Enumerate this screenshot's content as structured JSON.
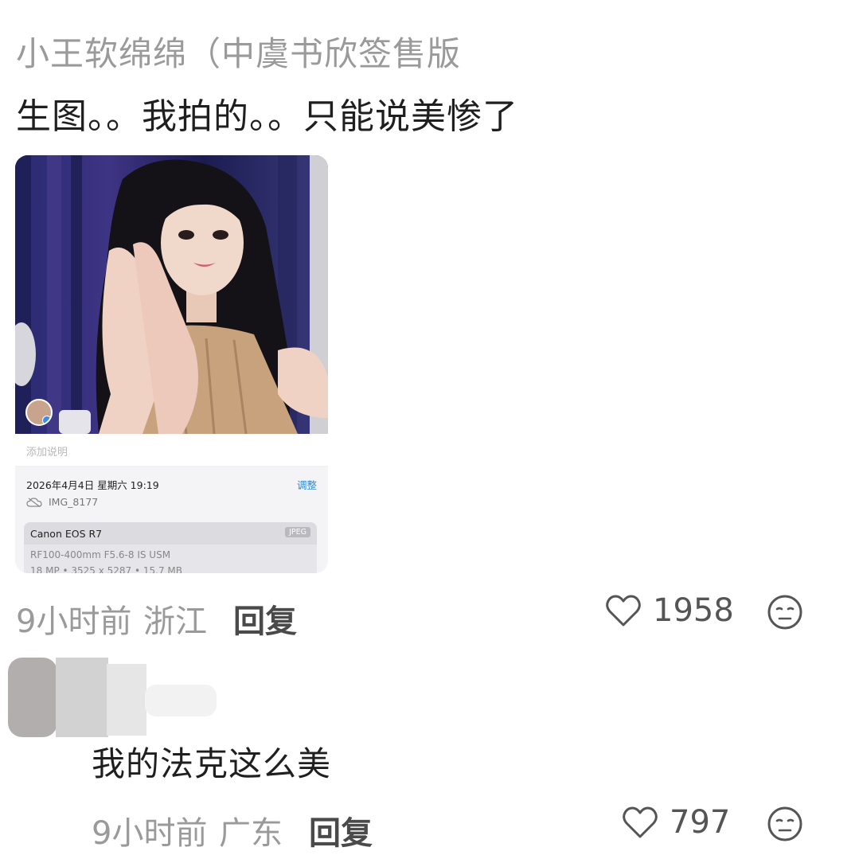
{
  "comment": {
    "username": "小王软绵绵（中虞书欣签售版",
    "text": "生图。。我拍的。。只能说美惨了",
    "photo": {
      "caption_placeholder": "添加说明",
      "datetime": "2026年4月4日 星期六 19:19",
      "adjust_label": "调整",
      "filename": "IMG_8177",
      "camera_model": "Canon EOS R7",
      "format": "JPEG",
      "lens": "RF100-400mm F5.6-8 IS USM",
      "specs": "18 MP • 3525 x 5287 • 15.7 MB"
    },
    "time": "9小时前",
    "location": "浙江",
    "reply_label": "回复",
    "likes": "1958",
    "like_icon": "heart-outline-icon",
    "reaction_icon": "neutral-face-icon"
  },
  "reply": {
    "text": "我的法克这么美",
    "time": "9小时前",
    "location": "广东",
    "reply_label": "回复",
    "likes": "797",
    "like_icon": "heart-outline-icon",
    "reaction_icon": "neutral-face-icon"
  }
}
